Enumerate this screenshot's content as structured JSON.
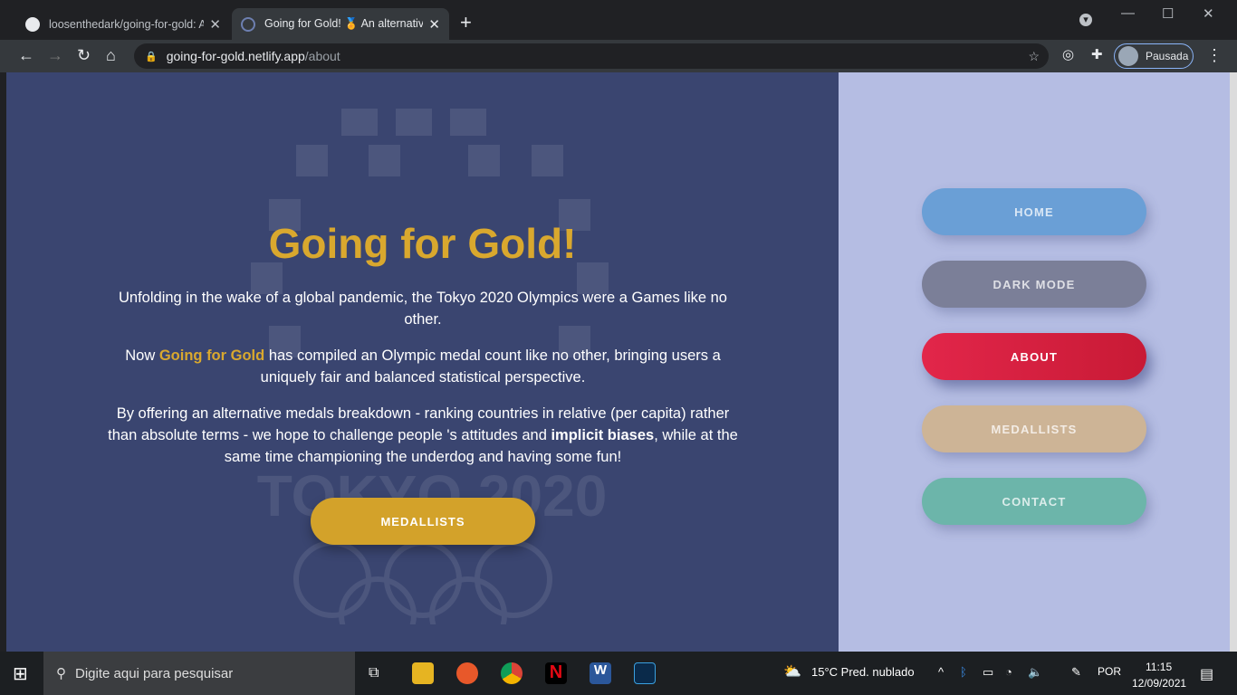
{
  "browser": {
    "tabs": [
      {
        "title": "loosenthedark/going-for-gold: A",
        "active": false
      },
      {
        "title": "Going for Gold! 🏅 An alternativ",
        "active": true
      }
    ],
    "url_host": "going-for-gold.netlify.app",
    "url_path": "/about",
    "profile": "Pausada"
  },
  "main": {
    "title": "Going for Gold!",
    "p1": "Unfolding in the wake of a global pandemic, the Tokyo 2020 Olympics were a Games like no other.",
    "p2_pre": "Now ",
    "p2_brand": "Going for Gold",
    "p2_post": " has compiled an Olympic medal count like no other, bringing users a uniquely fair and balanced statistical perspective.",
    "p3_pre": "By offering an alternative medals breakdown - ranking countries in relative (per capita) rather than absolute terms - we hope to challenge people 's attitudes and ",
    "p3_bold": "implicit biases",
    "p3_post": ", while at the same time championing the underdog and having some fun!",
    "cta": "MEDALLISTS",
    "watermark": "TOKYO 2020"
  },
  "nav": [
    {
      "label": "HOME",
      "color": "#6a9fd6"
    },
    {
      "label": "DARK MODE",
      "color": "#7b7f98"
    },
    {
      "label": "ABOUT",
      "color": "#d9203f"
    },
    {
      "label": "MEDALLISTS",
      "color": "#cdb496"
    },
    {
      "label": "CONTACT",
      "color": "#6cb5aa"
    }
  ],
  "taskbar": {
    "search": "Digite aqui para pesquisar",
    "weather": "15°C  Pred. nublado",
    "lang": "POR",
    "time": "11:15",
    "date": "12/09/2021"
  }
}
